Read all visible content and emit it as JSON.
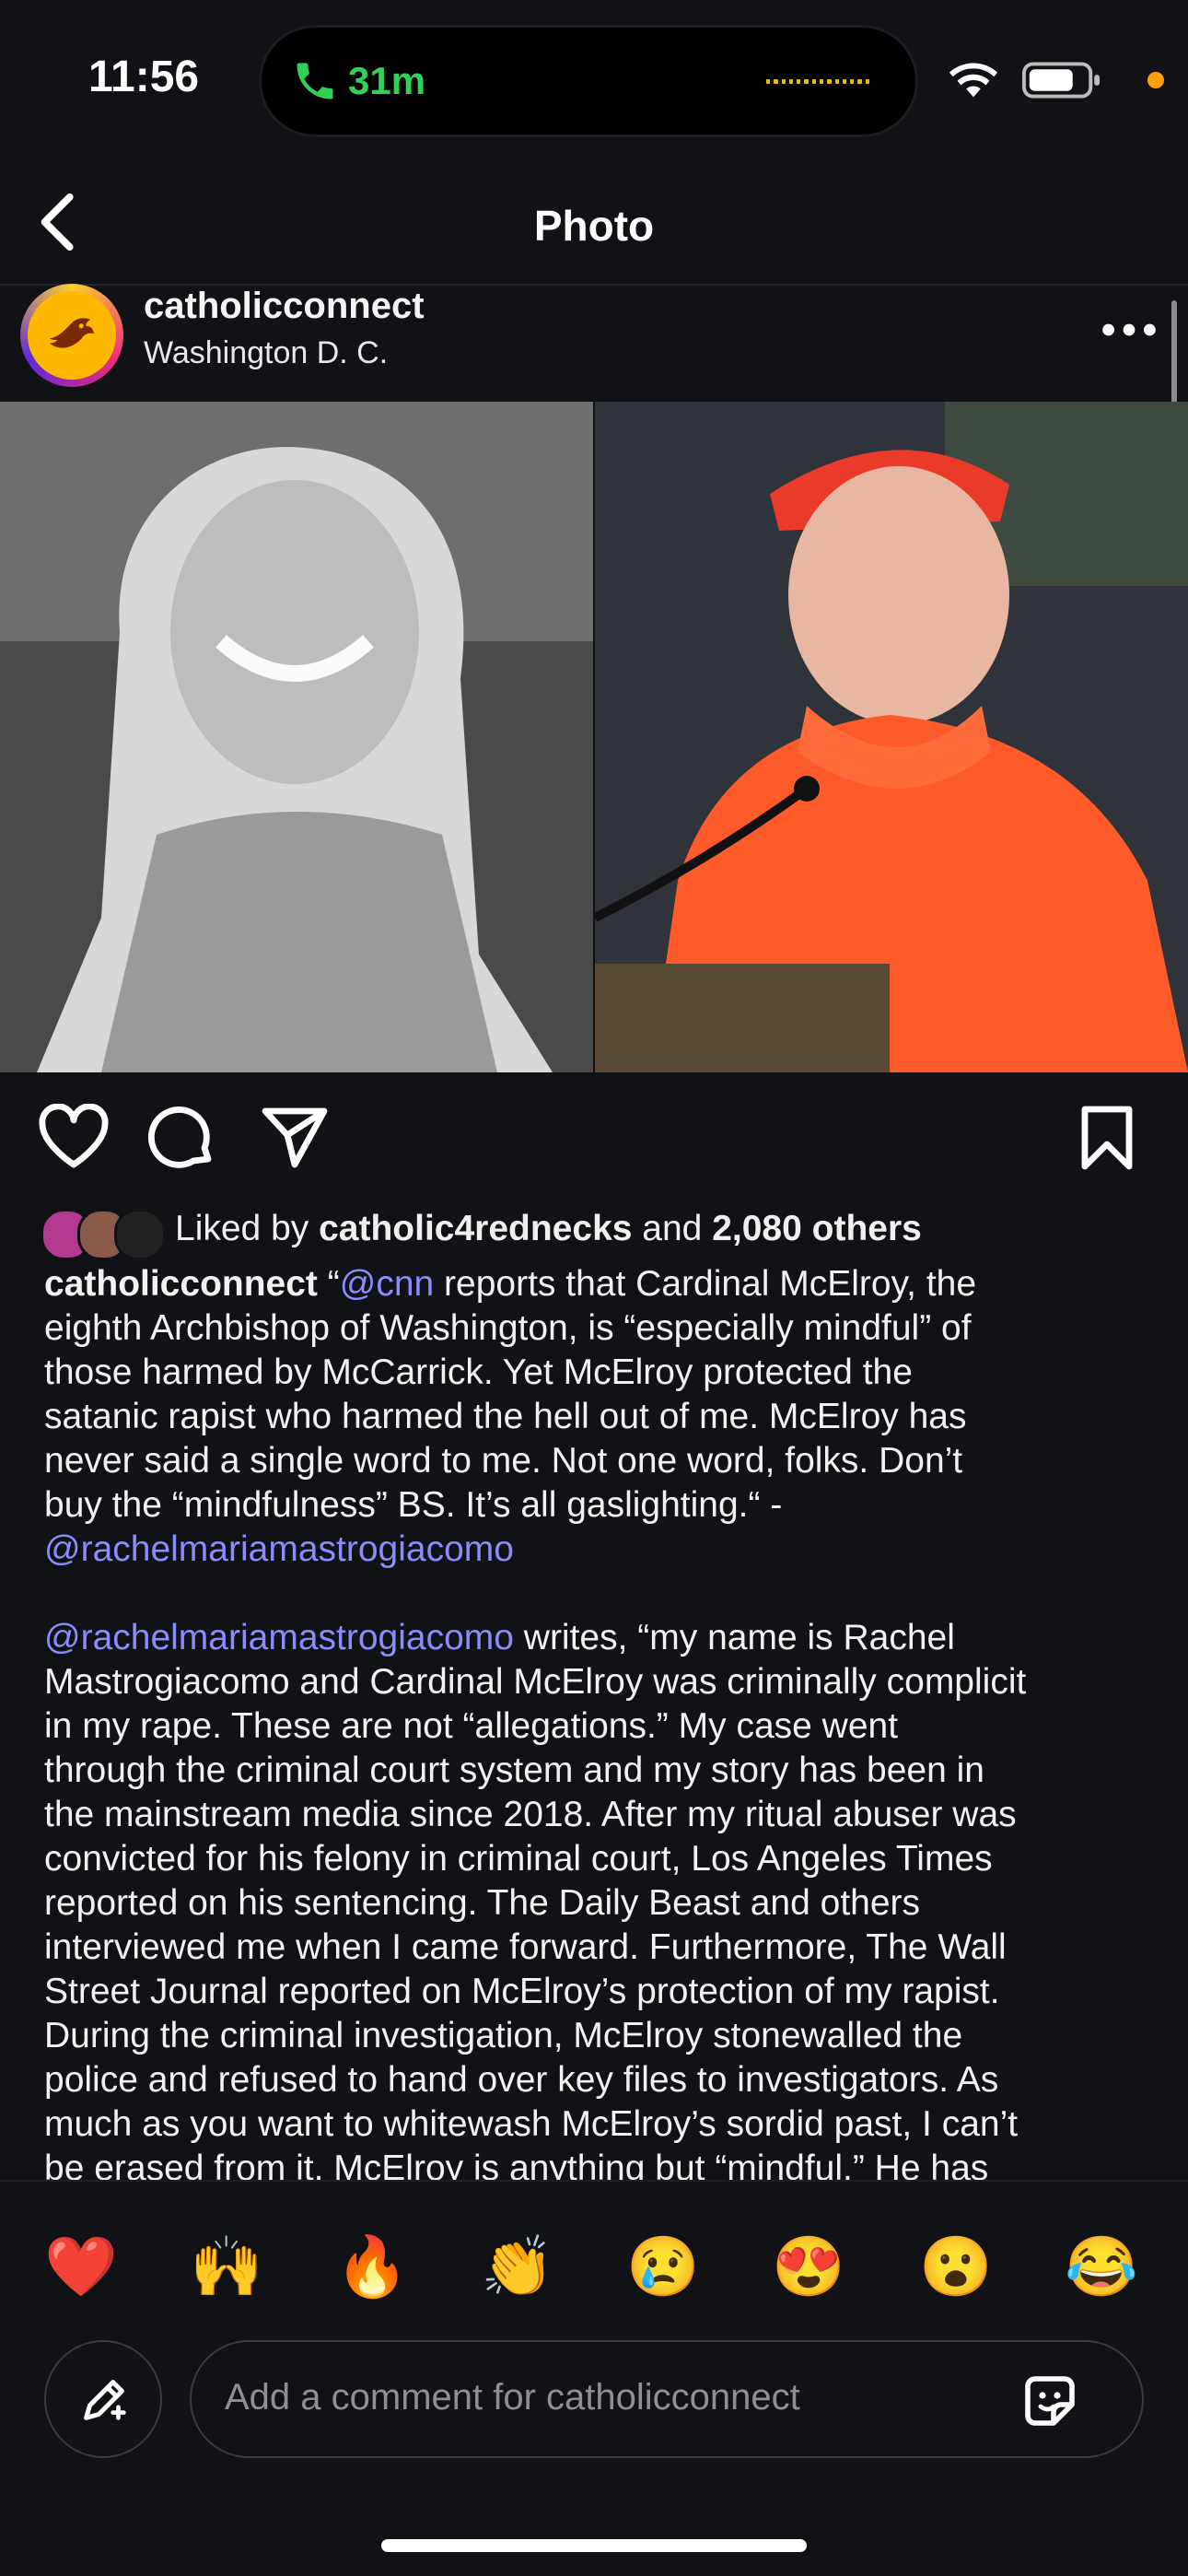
{
  "status_bar": {
    "time": "11:56",
    "call_duration": "31m"
  },
  "nav": {
    "title": "Photo"
  },
  "post": {
    "username": "catholicconnect",
    "location": "Washington D. C."
  },
  "likes": {
    "prefix": "Liked by ",
    "liker": "catholic4rednecks",
    "middle": " and ",
    "count": "2,080 others"
  },
  "caption": {
    "lines": [
      [
        {
          "t": "catholicconnect",
          "s": "bold"
        },
        {
          "t": " “"
        },
        {
          "t": "@cnn",
          "s": "mention"
        },
        {
          "t": " reports that Cardinal McElroy, the"
        }
      ],
      [
        {
          "t": "eighth Archbishop of Washington, is “especially mindful” of"
        }
      ],
      [
        {
          "t": "those harmed by McCarrick. Yet McElroy protected the"
        }
      ],
      [
        {
          "t": "satanic rapist who harmed the hell out of me. McElroy has"
        }
      ],
      [
        {
          "t": "never said a single word to me. Not one word, folks. Don’t"
        }
      ],
      [
        {
          "t": "buy the “mindfulness” BS. It’s all gaslighting.“ -"
        }
      ],
      [
        {
          "t": "@rachelmariamastrogiacomo",
          "s": "mention"
        }
      ],
      [],
      [
        {
          "t": "@rachelmariamastrogiacomo",
          "s": "mention"
        },
        {
          "t": " writes, “my name is Rachel"
        }
      ],
      [
        {
          "t": "Mastrogiacomo and Cardinal McElroy was criminally complicit"
        }
      ],
      [
        {
          "t": "in my rape. These are not “allegations.” My case went"
        }
      ],
      [
        {
          "t": "through the criminal court system and my story has been in"
        }
      ],
      [
        {
          "t": "the mainstream media since 2018. After my ritual abuser was"
        }
      ],
      [
        {
          "t": "convicted for his felony in criminal court, Los Angeles Times"
        }
      ],
      [
        {
          "t": "reported on his sentencing. The Daily Beast and others"
        }
      ],
      [
        {
          "t": "interviewed me when I came forward. Furthermore, The Wall"
        }
      ],
      [
        {
          "t": "Street Journal reported on McElroy’s protection of my rapist."
        }
      ],
      [
        {
          "t": "During the criminal investigation, McElroy stonewalled the"
        }
      ],
      [
        {
          "t": "police and refused to hand over key files to investigators. As"
        }
      ],
      [
        {
          "t": "much as you want to whitewash McElroy’s sordid past, I can’t"
        }
      ],
      [
        {
          "t": "be erased from it. McElroy is anything but “mindful.” He has"
        }
      ]
    ]
  },
  "emoji_bar": {
    "emojis": [
      "❤️",
      "🙌",
      "🔥",
      "👏",
      "😢",
      "😍",
      "😮",
      "😂"
    ]
  },
  "composer": {
    "placeholder": "Add a comment for catholicconnect"
  },
  "colors": {
    "background": "#111216",
    "mention": "#8b8bff",
    "call_green": "#31d158",
    "recording_dot": "#ff9f0a"
  },
  "icons": [
    "call-icon",
    "wifi-icon",
    "battery-icon",
    "back-icon",
    "more-icon",
    "heart-icon",
    "comment-icon",
    "share-icon",
    "bookmark-icon",
    "edit-icon",
    "sticker-icon"
  ]
}
